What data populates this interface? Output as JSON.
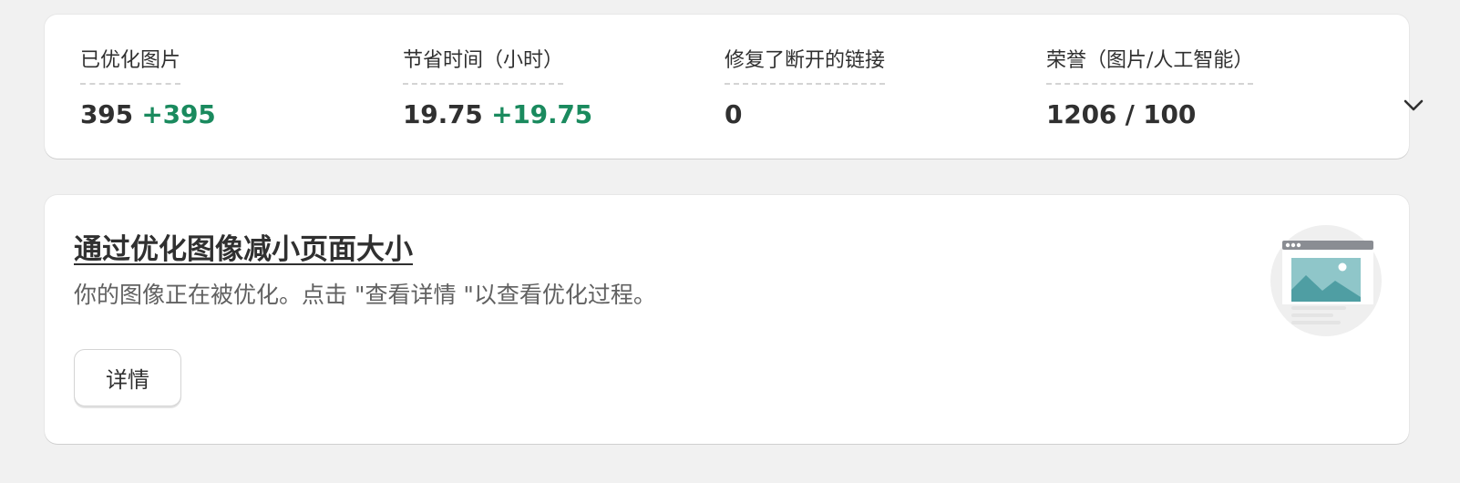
{
  "stats": [
    {
      "label": "已优化图片",
      "value": "395",
      "delta": "+395"
    },
    {
      "label": "节省时间（小时）",
      "value": "19.75",
      "delta": "+19.75"
    },
    {
      "label": "修复了断开的链接",
      "value": "0",
      "delta": ""
    },
    {
      "label": "荣誉（图片/人工智能）",
      "value": "1206 / 100",
      "delta": ""
    }
  ],
  "stats_toggle_icon": "chevron-down-icon",
  "feature": {
    "title": "通过优化图像减小页面大小",
    "description": "你的图像正在被优化。点击 \"查看详情 \"以查看优化过程。",
    "button_label": "详情",
    "illustration_icon": "image-browser-illustration"
  },
  "colors": {
    "background": "#f1f1f1",
    "card": "#ffffff",
    "delta_green": "#1a8a5e",
    "text": "#303030",
    "muted_text": "#616161",
    "illustration_teal": "#4f9ea3"
  }
}
